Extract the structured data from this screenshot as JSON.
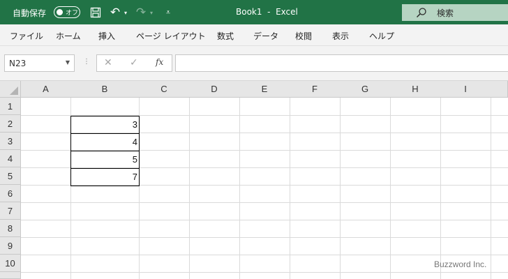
{
  "titlebar": {
    "autosave_label": "自動保存",
    "autosave_state": "オフ",
    "title": "Book1  -  Excel",
    "search_placeholder": "検索"
  },
  "ribbon_tabs": [
    "ファイル",
    "ホーム",
    "挿入",
    "ページ レイアウト",
    "数式",
    "データ",
    "校閲",
    "表示",
    "ヘルプ"
  ],
  "formula_bar": {
    "name_box": "N23",
    "fx_label": "fx",
    "formula": ""
  },
  "columns": [
    "A",
    "B",
    "C",
    "D",
    "E",
    "F",
    "G",
    "H",
    "I"
  ],
  "rows": [
    "1",
    "2",
    "3",
    "4",
    "5",
    "6",
    "7",
    "8",
    "9",
    "10"
  ],
  "cells": {
    "B2": "3",
    "B3": "4",
    "B4": "5",
    "B5": "7"
  },
  "watermark": "Buzzword Inc.",
  "colors": {
    "titlebar": "#217346",
    "ribbon": "#f3f3f3",
    "header": "#e6e6e6"
  }
}
